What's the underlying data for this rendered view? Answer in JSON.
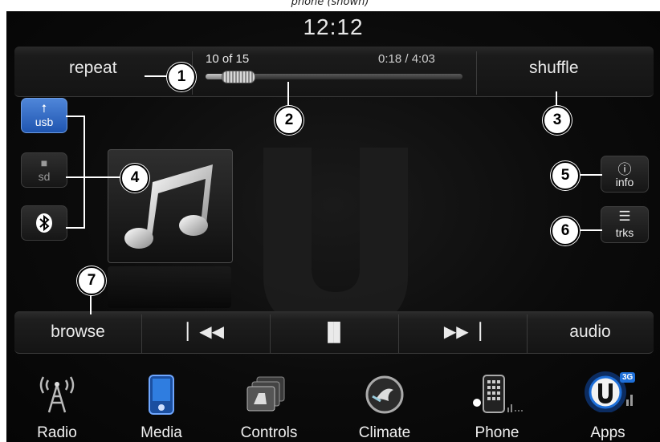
{
  "caption": "phone (shown)",
  "clock": "12:12",
  "top_bar": {
    "repeat_label": "repeat",
    "track_count": "10 of 15",
    "track_time": "0:18 / 4:03",
    "progress": 0.074,
    "shuffle_label": "shuffle"
  },
  "sources": [
    {
      "label": "usb",
      "icon": "usb-icon",
      "active": true
    },
    {
      "label": "sd",
      "icon": "sd-card-icon",
      "active": false
    },
    {
      "label": "",
      "icon": "bluetooth-icon",
      "active": false
    }
  ],
  "side_buttons": {
    "info_label": "info",
    "tracks_label": "trks"
  },
  "controls": {
    "browse_label": "browse",
    "previous_icon": "skip-previous-icon",
    "pause_icon": "pause-icon",
    "next_icon": "skip-next-icon",
    "audio_label": "audio"
  },
  "dock": [
    {
      "label": "Radio",
      "icon": "radio-tower-icon"
    },
    {
      "label": "Media",
      "icon": "media-player-icon",
      "active": true
    },
    {
      "label": "Controls",
      "icon": "seat-controls-icon"
    },
    {
      "label": "Climate",
      "icon": "climate-fan-icon"
    },
    {
      "label": "Phone",
      "icon": "phone-keypad-icon"
    },
    {
      "label": "Apps",
      "icon": "uconnect-apps-icon",
      "badge": "3G"
    }
  ],
  "callouts": [
    "1",
    "2",
    "3",
    "4",
    "5",
    "6",
    "7"
  ],
  "colors": {
    "active_source": "#2a62c0",
    "apps_glow": "#1e6fd8",
    "media_active": "#2f7de0"
  }
}
